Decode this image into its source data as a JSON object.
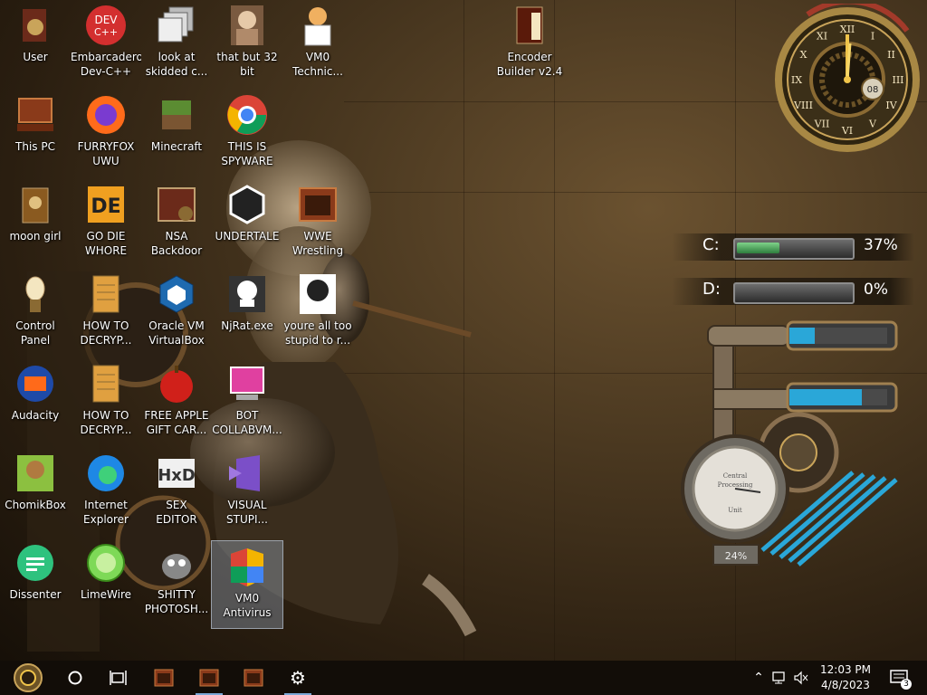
{
  "desktop": {
    "icons": [
      {
        "id": "user",
        "label": "User"
      },
      {
        "id": "devcpp",
        "label": "Embarcadero\nDev-C++"
      },
      {
        "id": "skidded",
        "label": "look at\nskidded c..."
      },
      {
        "id": "bit32",
        "label": "that but 32\nbit"
      },
      {
        "id": "vm0tech",
        "label": "VM0\nTechnic..."
      },
      {
        "id": "encoder",
        "label": "Encoder\nBuilder v2.4"
      },
      {
        "id": "thispc",
        "label": "This PC"
      },
      {
        "id": "furryfox",
        "label": "FURRYFOX\nUWU"
      },
      {
        "id": "minecraft",
        "label": "Minecraft"
      },
      {
        "id": "spyware",
        "label": "THIS IS\nSPYWARE"
      },
      {
        "id": "moongirl",
        "label": "moon girl"
      },
      {
        "id": "godie",
        "label": "GO DIE\nWHORE"
      },
      {
        "id": "nsa",
        "label": "NSA\nBackdoor"
      },
      {
        "id": "undertale",
        "label": "UNDERTALE"
      },
      {
        "id": "wwe",
        "label": "WWE\nWrestling"
      },
      {
        "id": "controlpanel",
        "label": "Control Panel"
      },
      {
        "id": "howto1",
        "label": "HOW TO\nDECRYP..."
      },
      {
        "id": "oraclevm",
        "label": "Oracle VM\nVirtualBox"
      },
      {
        "id": "njrat",
        "label": "NjRat.exe"
      },
      {
        "id": "stupid",
        "label": "youre all too\nstupid to r..."
      },
      {
        "id": "audacity",
        "label": "Audacity"
      },
      {
        "id": "howto2",
        "label": "HOW TO\nDECRYP..."
      },
      {
        "id": "applegift",
        "label": "FREE APPLE\nGIFT CAR..."
      },
      {
        "id": "botcollab",
        "label": "BOT\nCOLLABVM..."
      },
      {
        "id": "chomikbox",
        "label": "ChomikBox"
      },
      {
        "id": "ie",
        "label": "Internet\nExplorer"
      },
      {
        "id": "sexeditor",
        "label": "SEX\nEDITOR"
      },
      {
        "id": "visualstupi",
        "label": "VISUAL\nSTUPI..."
      },
      {
        "id": "dissenter",
        "label": "Dissenter"
      },
      {
        "id": "limewire",
        "label": "LimeWire"
      },
      {
        "id": "shittyphotosh",
        "label": "SHITTY\nPHOTOSH..."
      },
      {
        "id": "vm0antivirus",
        "label": "VM0\nAntivirus"
      }
    ]
  },
  "gadgets": {
    "clock": {
      "hour_numerals": [
        "XII",
        "I",
        "II",
        "III",
        "IV",
        "V",
        "VI",
        "VII",
        "VIII",
        "IX",
        "X",
        "XI"
      ],
      "date": "08",
      "time_hm": "12:03"
    },
    "drives": [
      {
        "letter": "C:",
        "percent_used": 37,
        "pct_label": "37%"
      },
      {
        "letter": "D:",
        "percent_used": 0,
        "pct_label": "0%"
      }
    ],
    "cpu_gauge": {
      "label_line1": "Central",
      "label_line2": "Processing",
      "label_line3": "Unit",
      "percent_label": "24%"
    }
  },
  "taskbar": {
    "time": "12:03 PM",
    "date": "4/8/2023",
    "notifications_count": "3"
  },
  "colors": {
    "taskbar": "#120d08",
    "drive_fill": "#4caf50",
    "tube_blue": "#2aa7d8"
  }
}
